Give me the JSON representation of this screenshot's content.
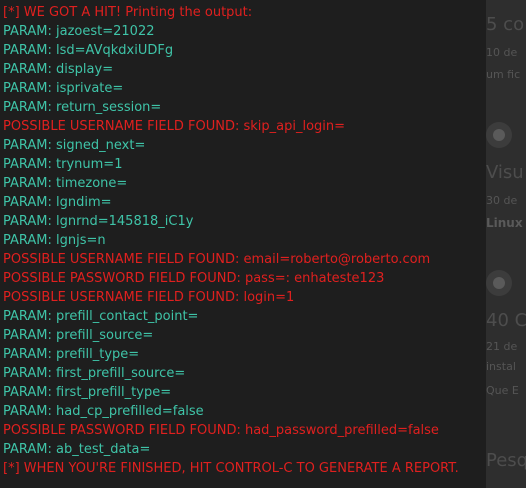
{
  "background": {
    "fragments": [
      {
        "text": "5 co"
      },
      {
        "text": "10 de"
      },
      {
        "text": "um fic"
      },
      {
        "text": "Visu"
      },
      {
        "text": "30 de"
      },
      {
        "text": "Linux"
      },
      {
        "text": "40 C"
      },
      {
        "text": "21 de"
      },
      {
        "text": "instal"
      },
      {
        "text": "Que E"
      },
      {
        "text": "Pesq"
      }
    ]
  },
  "terminal": {
    "lines": [
      {
        "text": "[*] WE GOT A HIT! Printing the output:",
        "kind": "prefix"
      },
      {
        "text": "PARAM: jazoest=21022",
        "kind": "param"
      },
      {
        "text": "PARAM: lsd=AVqkdxiUDFg",
        "kind": "param"
      },
      {
        "text": "PARAM: display=",
        "kind": "param"
      },
      {
        "text": "PARAM: isprivate=",
        "kind": "param"
      },
      {
        "text": "PARAM: return_session=",
        "kind": "param"
      },
      {
        "text": "POSSIBLE USERNAME FIELD FOUND: skip_api_login=",
        "kind": "alert"
      },
      {
        "text": "PARAM: signed_next=",
        "kind": "param"
      },
      {
        "text": "PARAM: trynum=1",
        "kind": "param"
      },
      {
        "text": "PARAM: timezone=",
        "kind": "param"
      },
      {
        "text": "PARAM: lgndim=",
        "kind": "param"
      },
      {
        "text": "PARAM: lgnrnd=145818_iC1y",
        "kind": "param"
      },
      {
        "text": "PARAM: lgnjs=n",
        "kind": "param"
      },
      {
        "text": "POSSIBLE USERNAME FIELD FOUND: email=roberto@roberto.com",
        "kind": "alert"
      },
      {
        "text": "POSSIBLE PASSWORD FIELD FOUND: pass=: enhateste123",
        "kind": "alert"
      },
      {
        "text": "POSSIBLE USERNAME FIELD FOUND: login=1",
        "kind": "alert"
      },
      {
        "text": "PARAM: prefill_contact_point=",
        "kind": "param"
      },
      {
        "text": "PARAM: prefill_source=",
        "kind": "param"
      },
      {
        "text": "PARAM: prefill_type=",
        "kind": "param"
      },
      {
        "text": "PARAM: first_prefill_source=",
        "kind": "param"
      },
      {
        "text": "PARAM: first_prefill_type=",
        "kind": "param"
      },
      {
        "text": "PARAM: had_cp_prefilled=false",
        "kind": "param"
      },
      {
        "text": "POSSIBLE PASSWORD FIELD FOUND: had_password_prefilled=false",
        "kind": "alert"
      },
      {
        "text": "PARAM: ab_test_data=",
        "kind": "param"
      },
      {
        "text": "[*] WHEN YOU'RE FINISHED, HIT CONTROL-C TO GENERATE A REPORT.",
        "kind": "prefix"
      }
    ],
    "colors": {
      "param": "#3fc4a8",
      "alert": "#e0201f",
      "background": "#1e1e1e"
    }
  }
}
